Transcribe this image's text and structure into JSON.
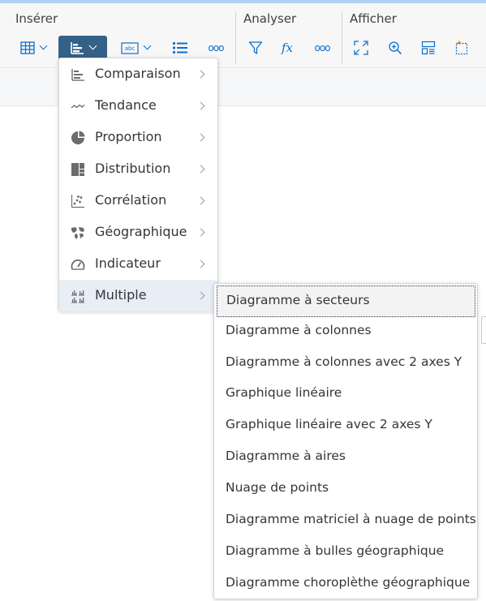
{
  "toolbar": {
    "groups": {
      "insert": "Insérer",
      "analyze": "Analyser",
      "view": "Afficher"
    },
    "more": "ooo"
  },
  "chart_menu": {
    "items": [
      {
        "label": "Comparaison",
        "icon": "bar-chart-horizontal-icon"
      },
      {
        "label": "Tendance",
        "icon": "trend-line-icon"
      },
      {
        "label": "Proportion",
        "icon": "pie-chart-icon"
      },
      {
        "label": "Distribution",
        "icon": "treemap-icon"
      },
      {
        "label": "Corrélation",
        "icon": "scatter-plot-icon"
      },
      {
        "label": "Géographique",
        "icon": "map-icon"
      },
      {
        "label": "Indicateur",
        "icon": "gauge-icon"
      },
      {
        "label": "Multiple",
        "icon": "multiple-charts-icon"
      }
    ],
    "highlighted": "Multiple"
  },
  "multiple_submenu": {
    "items": [
      "Diagramme à secteurs",
      "Diagramme à colonnes",
      "Diagramme à colonnes avec 2 axes Y",
      "Graphique linéaire",
      "Graphique linéaire avec 2 axes Y",
      "Diagramme à aires",
      "Nuage de points",
      "Diagramme matriciel à nuage de points",
      "Diagramme à bulles géographique",
      "Diagramme choroplèthe géographique"
    ],
    "selected": "Diagramme à secteurs"
  },
  "colors": {
    "accent": "#0a6ed1",
    "active_button": "#346187",
    "menu_highlight": "#e8eef5"
  }
}
